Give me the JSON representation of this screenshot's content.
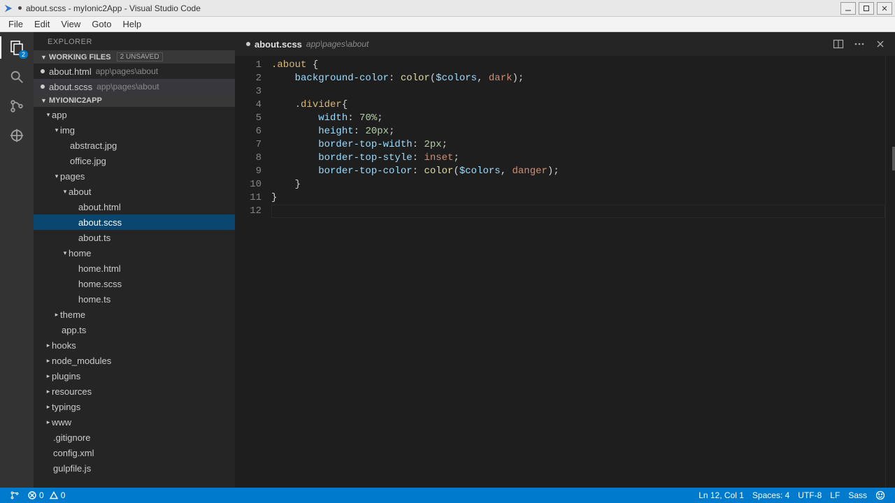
{
  "window": {
    "title": "about.scss - myIonic2App - Visual Studio Code"
  },
  "menubar": [
    "File",
    "Edit",
    "View",
    "Goto",
    "Help"
  ],
  "activitybar": {
    "explorer_badge": "2"
  },
  "sidebar": {
    "title": "EXPLORER",
    "working_files": {
      "label": "WORKING FILES",
      "badge": "2 UNSAVED",
      "items": [
        {
          "name": "about.html",
          "path": "app\\pages\\about",
          "dirty": true
        },
        {
          "name": "about.scss",
          "path": "app\\pages\\about",
          "dirty": true,
          "active": true
        }
      ]
    },
    "project": {
      "label": "MYIONIC2APP",
      "tree": [
        {
          "depth": 0,
          "kind": "folder",
          "open": true,
          "name": "app"
        },
        {
          "depth": 1,
          "kind": "folder",
          "open": true,
          "name": "img"
        },
        {
          "depth": 2,
          "kind": "file",
          "name": "abstract.jpg"
        },
        {
          "depth": 2,
          "kind": "file",
          "name": "office.jpg"
        },
        {
          "depth": 1,
          "kind": "folder",
          "open": true,
          "name": "pages"
        },
        {
          "depth": 2,
          "kind": "folder",
          "open": true,
          "name": "about"
        },
        {
          "depth": 3,
          "kind": "file",
          "name": "about.html"
        },
        {
          "depth": 3,
          "kind": "file",
          "name": "about.scss",
          "selected": true
        },
        {
          "depth": 3,
          "kind": "file",
          "name": "about.ts"
        },
        {
          "depth": 2,
          "kind": "folder",
          "open": true,
          "name": "home"
        },
        {
          "depth": 3,
          "kind": "file",
          "name": "home.html"
        },
        {
          "depth": 3,
          "kind": "file",
          "name": "home.scss"
        },
        {
          "depth": 3,
          "kind": "file",
          "name": "home.ts"
        },
        {
          "depth": 1,
          "kind": "folder",
          "open": false,
          "name": "theme"
        },
        {
          "depth": 1,
          "kind": "file",
          "name": "app.ts"
        },
        {
          "depth": 0,
          "kind": "folder",
          "open": false,
          "name": "hooks"
        },
        {
          "depth": 0,
          "kind": "folder",
          "open": false,
          "name": "node_modules"
        },
        {
          "depth": 0,
          "kind": "folder",
          "open": false,
          "name": "plugins"
        },
        {
          "depth": 0,
          "kind": "folder",
          "open": false,
          "name": "resources"
        },
        {
          "depth": 0,
          "kind": "folder",
          "open": false,
          "name": "typings"
        },
        {
          "depth": 0,
          "kind": "folder",
          "open": false,
          "name": "www"
        },
        {
          "depth": 0,
          "kind": "file",
          "name": ".gitignore"
        },
        {
          "depth": 0,
          "kind": "file",
          "name": "config.xml"
        },
        {
          "depth": 0,
          "kind": "file",
          "name": "gulpfile.js"
        }
      ]
    }
  },
  "tab": {
    "filename": "about.scss",
    "subpath": "app\\pages\\about",
    "dirty": true
  },
  "editor": {
    "lines": [
      [
        {
          "t": "sel",
          "v": ".about"
        },
        {
          "t": "punc",
          "v": " {"
        }
      ],
      [
        {
          "t": "indent",
          "v": "    "
        },
        {
          "t": "prop",
          "v": "background-color"
        },
        {
          "t": "punc",
          "v": ": "
        },
        {
          "t": "func",
          "v": "color"
        },
        {
          "t": "punc",
          "v": "("
        },
        {
          "t": "var",
          "v": "$colors"
        },
        {
          "t": "punc",
          "v": ", "
        },
        {
          "t": "val",
          "v": "dark"
        },
        {
          "t": "punc",
          "v": ");"
        }
      ],
      [],
      [
        {
          "t": "indent",
          "v": "    "
        },
        {
          "t": "sel",
          "v": ".divider"
        },
        {
          "t": "punc",
          "v": "{"
        }
      ],
      [
        {
          "t": "indent",
          "v": "        "
        },
        {
          "t": "prop",
          "v": "width"
        },
        {
          "t": "punc",
          "v": ": "
        },
        {
          "t": "num",
          "v": "70%"
        },
        {
          "t": "punc",
          "v": ";"
        }
      ],
      [
        {
          "t": "indent",
          "v": "        "
        },
        {
          "t": "prop",
          "v": "height"
        },
        {
          "t": "punc",
          "v": ": "
        },
        {
          "t": "num",
          "v": "20px"
        },
        {
          "t": "punc",
          "v": ";"
        }
      ],
      [
        {
          "t": "indent",
          "v": "        "
        },
        {
          "t": "prop",
          "v": "border-top-width"
        },
        {
          "t": "punc",
          "v": ": "
        },
        {
          "t": "num",
          "v": "2px"
        },
        {
          "t": "punc",
          "v": ";"
        }
      ],
      [
        {
          "t": "indent",
          "v": "        "
        },
        {
          "t": "prop",
          "v": "border-top-style"
        },
        {
          "t": "punc",
          "v": ": "
        },
        {
          "t": "val",
          "v": "inset"
        },
        {
          "t": "punc",
          "v": ";"
        }
      ],
      [
        {
          "t": "indent",
          "v": "        "
        },
        {
          "t": "prop",
          "v": "border-top-color"
        },
        {
          "t": "punc",
          "v": ": "
        },
        {
          "t": "func",
          "v": "color"
        },
        {
          "t": "punc",
          "v": "("
        },
        {
          "t": "var",
          "v": "$colors"
        },
        {
          "t": "punc",
          "v": ", "
        },
        {
          "t": "val",
          "v": "danger"
        },
        {
          "t": "punc",
          "v": ");"
        }
      ],
      [
        {
          "t": "indent",
          "v": "    "
        },
        {
          "t": "punc",
          "v": "}"
        }
      ],
      [
        {
          "t": "punc",
          "v": "}"
        }
      ],
      []
    ]
  },
  "statusbar": {
    "errors": "0",
    "warnings": "0",
    "position": "Ln 12, Col 1",
    "spaces": "Spaces: 4",
    "encoding": "UTF-8",
    "eol": "LF",
    "language": "Sass"
  }
}
